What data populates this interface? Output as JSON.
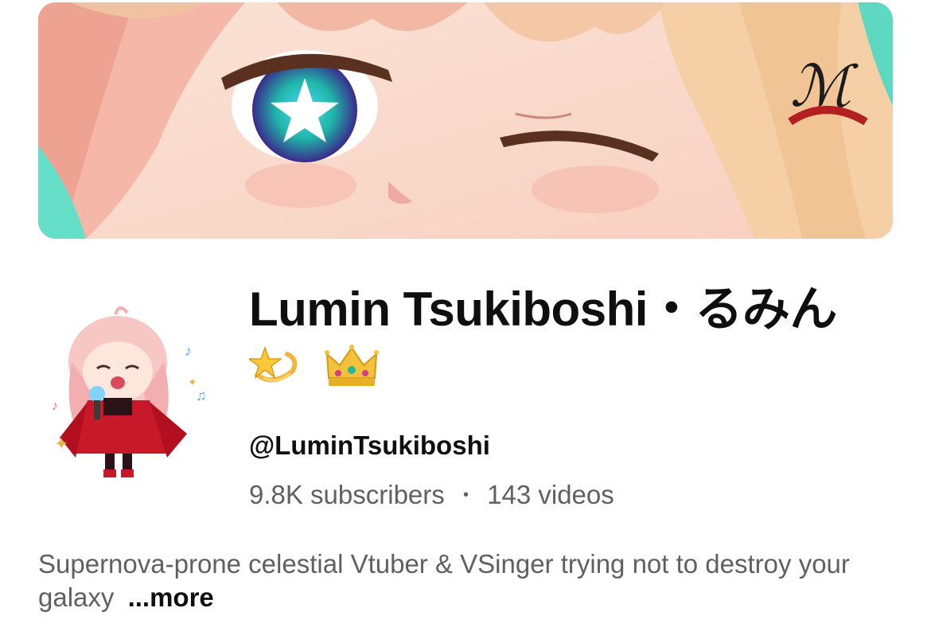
{
  "channel": {
    "name": "Lumin Tsukiboshi・るみん",
    "name_emojis": [
      "dizzy-icon",
      "crown-icon"
    ],
    "handle": "@LuminTsukiboshi",
    "subscribers": "9.8K subscribers",
    "separator": "•",
    "videos": "143 videos",
    "description": "Supernova-prone celestial Vtuber & VSinger trying not to destroy your galaxy",
    "more_label": "...more"
  },
  "colors": {
    "text_primary": "#0f0f0f",
    "text_secondary": "#606060",
    "background": "#ffffff"
  }
}
